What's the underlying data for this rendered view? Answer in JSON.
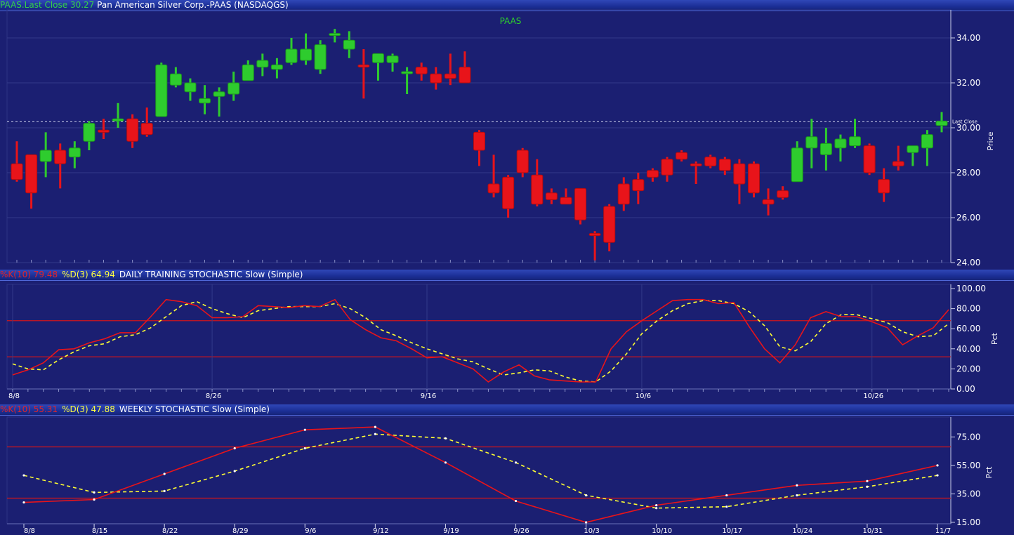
{
  "header": {
    "symbol_close": "PAAS.Last Close 30.27",
    "company": "Pan American Silver Corp.-PAAS (NASDAQGS)"
  },
  "colors": {
    "background": "#1b1f72",
    "up": "#2ecc2e",
    "down": "#e8141a",
    "k_line": "#e8141a",
    "d_line": "#ffff33",
    "level_line": "#d0151b",
    "grid": "#333a8a"
  },
  "chart_data": [
    {
      "type": "candlestick",
      "title": "PAAS",
      "ylabel": "Price",
      "ylim": [
        24,
        35
      ],
      "yticks": [
        "34.00",
        "32.00",
        "30.00",
        "28.00",
        "26.00",
        "24.00"
      ],
      "last_close": 30.27,
      "last_close_label": "Last Close",
      "bars": [
        {
          "o": 28.4,
          "h": 29.4,
          "l": 27.6,
          "c": 27.7
        },
        {
          "o": 28.8,
          "h": 28.8,
          "l": 26.4,
          "c": 27.1
        },
        {
          "o": 28.5,
          "h": 29.8,
          "l": 27.8,
          "c": 29.0
        },
        {
          "o": 29.0,
          "h": 29.3,
          "l": 27.3,
          "c": 28.4
        },
        {
          "o": 28.7,
          "h": 29.4,
          "l": 28.2,
          "c": 29.1
        },
        {
          "o": 29.4,
          "h": 30.3,
          "l": 29.0,
          "c": 30.2
        },
        {
          "o": 29.9,
          "h": 30.4,
          "l": 29.5,
          "c": 29.8
        },
        {
          "o": 30.3,
          "h": 31.1,
          "l": 30.0,
          "c": 30.4
        },
        {
          "o": 30.4,
          "h": 30.6,
          "l": 29.1,
          "c": 29.4
        },
        {
          "o": 30.2,
          "h": 30.9,
          "l": 29.6,
          "c": 29.7
        },
        {
          "o": 30.5,
          "h": 32.9,
          "l": 30.5,
          "c": 32.8
        },
        {
          "o": 31.9,
          "h": 32.7,
          "l": 31.8,
          "c": 32.4
        },
        {
          "o": 31.6,
          "h": 32.2,
          "l": 31.2,
          "c": 32.0
        },
        {
          "o": 31.1,
          "h": 31.9,
          "l": 30.6,
          "c": 31.3
        },
        {
          "o": 31.4,
          "h": 31.8,
          "l": 30.5,
          "c": 31.6
        },
        {
          "o": 31.5,
          "h": 32.5,
          "l": 31.2,
          "c": 32.0
        },
        {
          "o": 32.1,
          "h": 33.0,
          "l": 32.1,
          "c": 32.8
        },
        {
          "o": 32.7,
          "h": 33.3,
          "l": 32.3,
          "c": 33.0
        },
        {
          "o": 32.6,
          "h": 33.1,
          "l": 32.2,
          "c": 32.8
        },
        {
          "o": 32.9,
          "h": 34.0,
          "l": 32.8,
          "c": 33.5
        },
        {
          "o": 33.0,
          "h": 34.2,
          "l": 32.8,
          "c": 33.5
        },
        {
          "o": 32.6,
          "h": 33.9,
          "l": 32.4,
          "c": 33.7
        },
        {
          "o": 34.2,
          "h": 34.4,
          "l": 33.8,
          "c": 34.2
        },
        {
          "o": 33.5,
          "h": 34.3,
          "l": 33.1,
          "c": 33.9
        },
        {
          "o": 32.8,
          "h": 33.5,
          "l": 31.3,
          "c": 32.7
        },
        {
          "o": 32.9,
          "h": 33.3,
          "l": 32.1,
          "c": 33.3
        },
        {
          "o": 32.9,
          "h": 33.3,
          "l": 32.5,
          "c": 33.2
        },
        {
          "o": 32.5,
          "h": 32.7,
          "l": 31.5,
          "c": 32.5
        },
        {
          "o": 32.7,
          "h": 32.9,
          "l": 32.1,
          "c": 32.4
        },
        {
          "o": 32.4,
          "h": 32.7,
          "l": 31.7,
          "c": 32.0
        },
        {
          "o": 32.4,
          "h": 33.3,
          "l": 31.9,
          "c": 32.2
        },
        {
          "o": 32.7,
          "h": 33.4,
          "l": 32.0,
          "c": 32.0
        },
        {
          "o": 29.8,
          "h": 29.9,
          "l": 28.3,
          "c": 29.0
        },
        {
          "o": 27.5,
          "h": 28.8,
          "l": 26.9,
          "c": 27.1
        },
        {
          "o": 27.8,
          "h": 27.9,
          "l": 26.0,
          "c": 26.4
        },
        {
          "o": 29.0,
          "h": 29.1,
          "l": 27.8,
          "c": 28.0
        },
        {
          "o": 27.9,
          "h": 28.6,
          "l": 26.5,
          "c": 26.6
        },
        {
          "o": 27.1,
          "h": 27.3,
          "l": 26.6,
          "c": 26.8
        },
        {
          "o": 26.9,
          "h": 27.3,
          "l": 26.6,
          "c": 26.6
        },
        {
          "o": 27.3,
          "h": 27.3,
          "l": 25.7,
          "c": 25.9
        },
        {
          "o": 25.3,
          "h": 25.4,
          "l": 24.1,
          "c": 25.2
        },
        {
          "o": 26.5,
          "h": 26.6,
          "l": 24.5,
          "c": 24.9
        },
        {
          "o": 27.5,
          "h": 27.8,
          "l": 26.3,
          "c": 26.6
        },
        {
          "o": 27.7,
          "h": 28.0,
          "l": 26.6,
          "c": 27.2
        },
        {
          "o": 28.1,
          "h": 28.2,
          "l": 27.6,
          "c": 27.8
        },
        {
          "o": 28.6,
          "h": 28.7,
          "l": 27.6,
          "c": 27.9
        },
        {
          "o": 28.9,
          "h": 29.0,
          "l": 28.5,
          "c": 28.6
        },
        {
          "o": 28.4,
          "h": 28.5,
          "l": 27.5,
          "c": 28.3
        },
        {
          "o": 28.7,
          "h": 28.8,
          "l": 28.2,
          "c": 28.3
        },
        {
          "o": 28.6,
          "h": 28.7,
          "l": 27.9,
          "c": 28.1
        },
        {
          "o": 28.4,
          "h": 28.6,
          "l": 26.6,
          "c": 27.5
        },
        {
          "o": 28.4,
          "h": 28.5,
          "l": 26.9,
          "c": 27.1
        },
        {
          "o": 26.8,
          "h": 27.3,
          "l": 26.1,
          "c": 26.6
        },
        {
          "o": 27.2,
          "h": 27.4,
          "l": 26.8,
          "c": 26.9
        },
        {
          "o": 27.6,
          "h": 29.4,
          "l": 27.6,
          "c": 29.1
        },
        {
          "o": 29.1,
          "h": 30.4,
          "l": 28.2,
          "c": 29.6
        },
        {
          "o": 28.8,
          "h": 30.0,
          "l": 28.1,
          "c": 29.3
        },
        {
          "o": 29.1,
          "h": 29.7,
          "l": 28.5,
          "c": 29.5
        },
        {
          "o": 29.2,
          "h": 30.4,
          "l": 29.1,
          "c": 29.6
        },
        {
          "o": 29.2,
          "h": 29.3,
          "l": 27.9,
          "c": 28.0
        },
        {
          "o": 27.7,
          "h": 28.2,
          "l": 26.7,
          "c": 27.1
        },
        {
          "o": 28.5,
          "h": 29.2,
          "l": 28.1,
          "c": 28.3
        },
        {
          "o": 28.9,
          "h": 29.2,
          "l": 28.3,
          "c": 29.2
        },
        {
          "o": 29.1,
          "h": 29.9,
          "l": 28.3,
          "c": 29.7
        },
        {
          "o": 30.1,
          "h": 30.7,
          "l": 29.8,
          "c": 30.3
        }
      ]
    },
    {
      "type": "line",
      "title_k": "%K(10) 79.48",
      "title_d": "%D(3) 64.94",
      "title_rest": "DAILY TRAINING STOCHASTIC Slow (Simple)",
      "ylabel": "Pct",
      "ylim": [
        0,
        100
      ],
      "yticks": [
        "100.00",
        "80.00",
        "60.00",
        "40.00",
        "20.00",
        "0.00"
      ],
      "levels": [
        68,
        32
      ],
      "xtick_labels": [
        {
          "i": 0,
          "label": "8/8"
        },
        {
          "i": 13,
          "label": "8/26"
        },
        {
          "i": 27,
          "label": "9/16"
        },
        {
          "i": 41,
          "label": "10/6"
        },
        {
          "i": 56,
          "label": "10/26"
        }
      ],
      "series": [
        {
          "name": "%K(10)",
          "values": [
            14,
            19,
            26,
            39,
            40,
            46,
            50,
            56,
            56,
            72,
            89,
            87,
            83,
            71,
            71,
            72,
            83,
            82,
            81,
            83,
            82,
            89,
            69,
            59,
            51,
            48,
            40,
            31,
            32,
            26,
            20,
            7,
            17,
            24,
            13,
            9,
            8,
            7,
            7,
            40,
            57,
            68,
            78,
            88,
            89,
            89,
            85,
            86,
            62,
            40,
            26,
            44,
            71,
            77,
            72,
            72,
            67,
            61,
            44,
            53,
            61,
            79
          ]
        },
        {
          "name": "%D(3)",
          "values": [
            25,
            20,
            19,
            29,
            37,
            43,
            45,
            52,
            54,
            61,
            72,
            83,
            87,
            80,
            75,
            71,
            78,
            80,
            82,
            82,
            82,
            85,
            80,
            71,
            59,
            53,
            46,
            40,
            35,
            30,
            27,
            20,
            14,
            16,
            19,
            18,
            12,
            8,
            7,
            18,
            35,
            55,
            68,
            78,
            85,
            88,
            88,
            85,
            77,
            63,
            42,
            38,
            47,
            65,
            74,
            74,
            70,
            66,
            57,
            52,
            53,
            65
          ]
        }
      ]
    },
    {
      "type": "line",
      "title_k": "%K(10) 55.31",
      "title_d": "%D(3) 47.88",
      "title_rest": "WEEKLY STOCHASTIC Slow (Simple)",
      "ylabel": "Pct",
      "ylim": [
        14,
        86
      ],
      "yticks": [
        "75.00",
        "55.00",
        "35.00",
        "15.00"
      ],
      "levels": [
        68,
        32
      ],
      "categories": [
        "8/8",
        "8/15",
        "8/22",
        "8/29",
        "9/6",
        "9/12",
        "9/19",
        "9/26",
        "10/3",
        "10/10",
        "10/17",
        "10/24",
        "10/31",
        "11/7"
      ],
      "series": [
        {
          "name": "%K(10)",
          "values": [
            29,
            31,
            49,
            67,
            80,
            82,
            57,
            30,
            15,
            27,
            34,
            41,
            44,
            55
          ]
        },
        {
          "name": "%D(3)",
          "values": [
            48,
            36,
            37,
            51,
            67,
            77,
            74,
            57,
            34,
            25,
            26,
            34,
            40,
            48
          ]
        }
      ]
    }
  ]
}
